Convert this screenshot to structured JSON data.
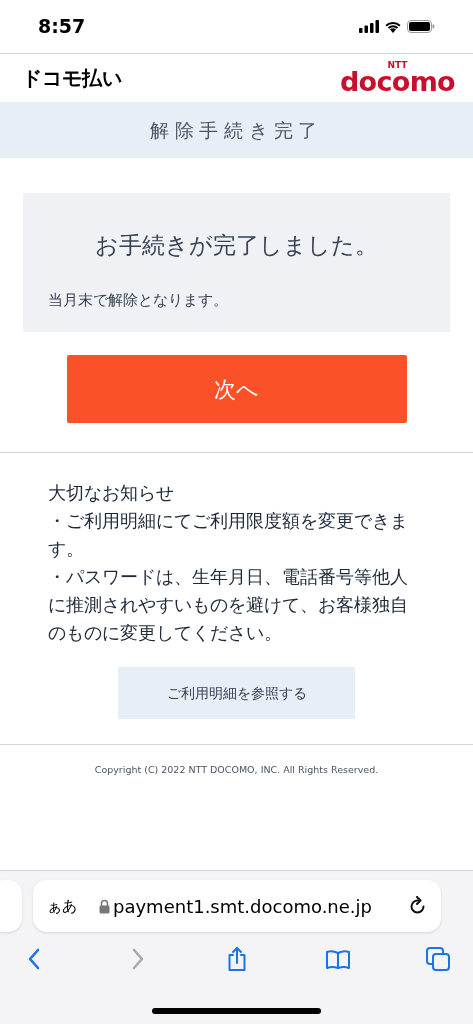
{
  "status_bar": {
    "time": "8:57"
  },
  "header": {
    "service_name": "ドコモ払い",
    "logo_small": "NTT",
    "logo": "docomo"
  },
  "page_title": "解除手続き完了",
  "result": {
    "title": "お手続きが完了しました。",
    "message": "当月末で解除となります。"
  },
  "next_button": "次へ",
  "notice": {
    "heading": "大切なお知らせ",
    "items": [
      "・ご利用明細にてご利用限度額を変更できます。",
      "・パスワードは、生年月日、電話番号等他人に推測されやすいものを避けて、お客様独自のものに変更してください。"
    ]
  },
  "statement_button": "ご利用明細を参照する",
  "footer": {
    "copyright": "Copyright (C) 2022 NTT DOCOMO, INC. All Rights Reserved."
  },
  "browser": {
    "text_size_button": "ぁあ",
    "url": "payment1.smt.docomo.ne.jp",
    "toolbar": [
      {
        "kind": "back",
        "disabled": false
      },
      {
        "kind": "forward",
        "disabled": true
      },
      {
        "kind": "share",
        "disabled": false
      },
      {
        "kind": "bookmarks",
        "disabled": false
      },
      {
        "kind": "tabs",
        "disabled": false
      }
    ]
  }
}
